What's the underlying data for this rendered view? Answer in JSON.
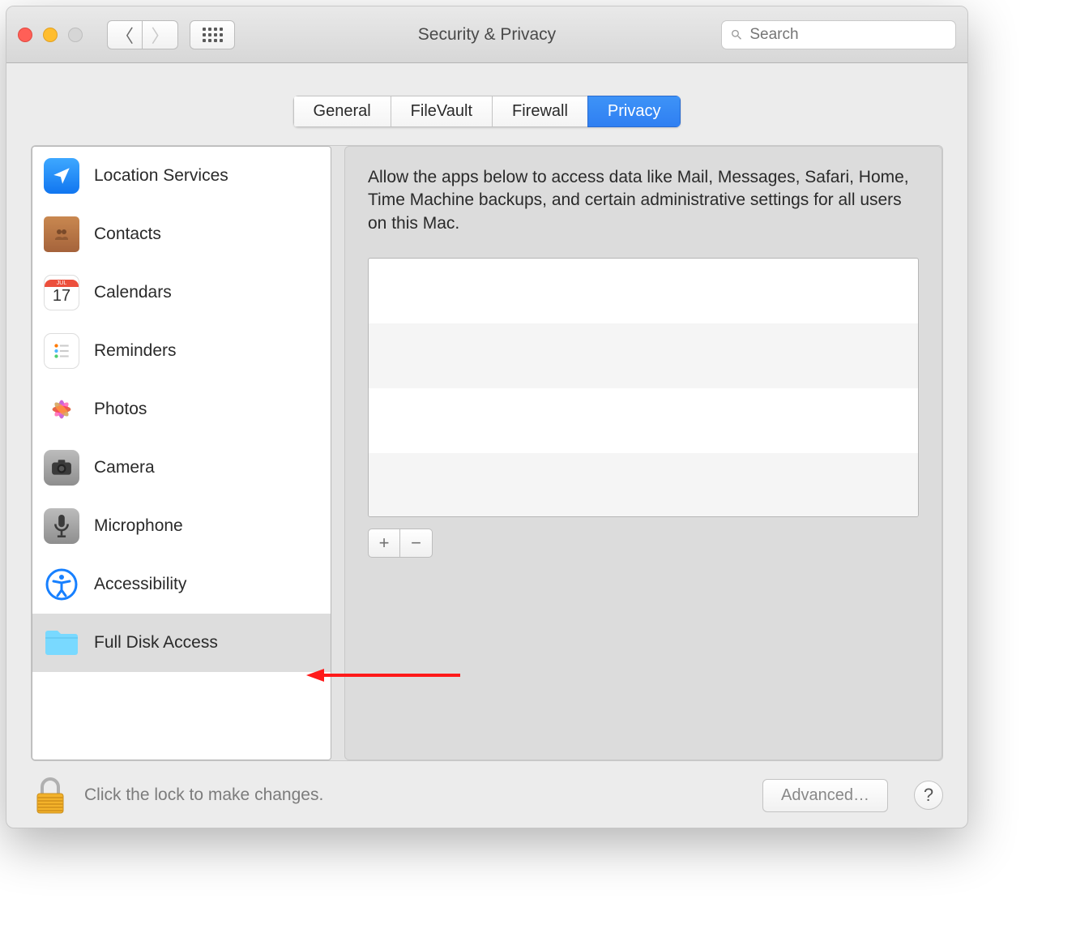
{
  "window": {
    "title": "Security & Privacy"
  },
  "search": {
    "placeholder": "Search"
  },
  "tabs": [
    {
      "label": "General"
    },
    {
      "label": "FileVault"
    },
    {
      "label": "Firewall"
    },
    {
      "label": "Privacy",
      "active": true
    }
  ],
  "categories": [
    {
      "label": "Location Services",
      "icon": "location"
    },
    {
      "label": "Contacts",
      "icon": "contacts"
    },
    {
      "label": "Calendars",
      "icon": "calendar",
      "badge_day": "17",
      "badge_month": "JUL"
    },
    {
      "label": "Reminders",
      "icon": "reminders"
    },
    {
      "label": "Photos",
      "icon": "photos"
    },
    {
      "label": "Camera",
      "icon": "camera"
    },
    {
      "label": "Microphone",
      "icon": "microphone"
    },
    {
      "label": "Accessibility",
      "icon": "accessibility"
    },
    {
      "label": "Full Disk Access",
      "icon": "folder",
      "selected": true
    }
  ],
  "detail": {
    "description": "Allow the apps below to access data like Mail, Messages, Safari, Home, Time Machine backups, and certain administrative settings for all users on this Mac."
  },
  "buttons": {
    "add": "+",
    "remove": "−"
  },
  "footer": {
    "lock_text": "Click the lock to make changes.",
    "advanced": "Advanced…",
    "help": "?"
  }
}
